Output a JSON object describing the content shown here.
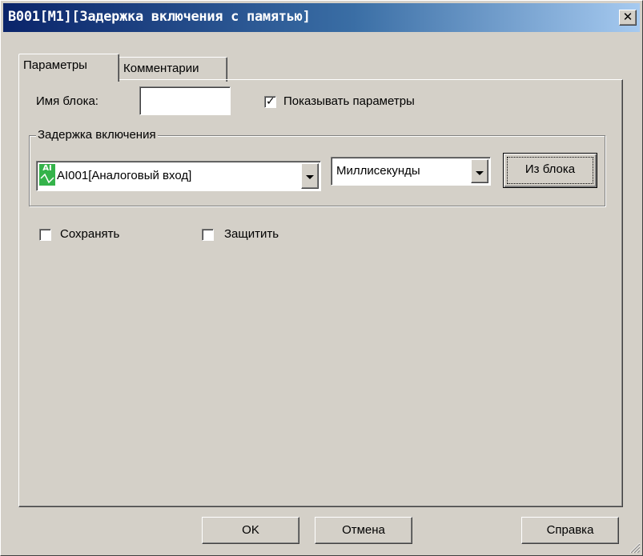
{
  "window": {
    "title": "B001[M1][Задержка включения с памятью]",
    "close_glyph": "✕"
  },
  "tabs": [
    {
      "label": "Параметры",
      "active": true
    },
    {
      "label": "Комментарии",
      "active": false
    }
  ],
  "params": {
    "block_name_label": "Имя блока:",
    "block_name_value": "",
    "show_params_label": "Показывать параметры",
    "show_params_checked": true,
    "group_label": "Задержка включения",
    "source_icon": "AI",
    "source_value": "AI001[Аналоговый вход]",
    "unit_value": "Миллисекунды",
    "from_block_label": "Из блока",
    "retain_label": "Сохранять",
    "retain_checked": false,
    "protect_label": "Защитить",
    "protect_checked": false
  },
  "footer": {
    "ok_label": "OK",
    "cancel_label": "Отмена",
    "help_label": "Справка"
  },
  "colors": {
    "title_start": "#0a246a",
    "title_end": "#a6caf0",
    "face": "#d4d0c8",
    "icon_green": "#34b34a"
  }
}
